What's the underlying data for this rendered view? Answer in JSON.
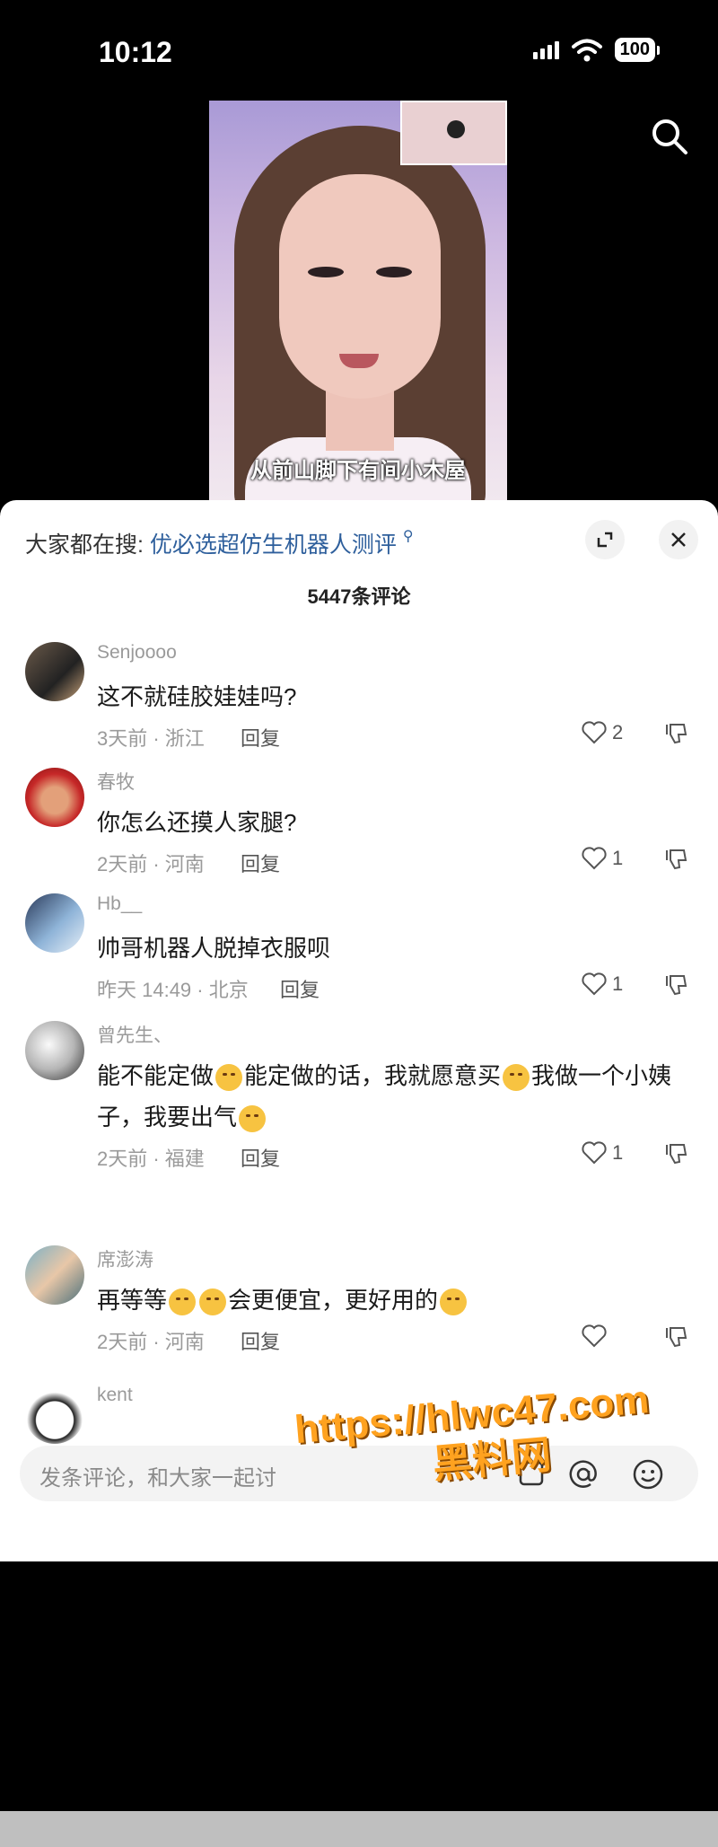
{
  "status_bar": {
    "time": "10:12",
    "battery": "100"
  },
  "video": {
    "caption": "从前山脚下有间小木屋"
  },
  "sheet": {
    "trending_label": "大家都在搜:",
    "trending_query": "优必选超仿生机器人测评",
    "comment_count": "5447条评论"
  },
  "comments": [
    {
      "user": "Senjoooo",
      "text": "这不就硅胶娃娃吗?",
      "meta": "3天前 · 浙江",
      "reply": "回复",
      "likes": "2"
    },
    {
      "user": "春牧",
      "text": "你怎么还摸人家腿?",
      "meta": "2天前 · 河南",
      "reply": "回复",
      "likes": "1"
    },
    {
      "user": "Hb__",
      "text": "帅哥机器人脱掉衣服呗",
      "meta": "昨天 14:49 · 北京",
      "reply": "回复",
      "likes": "1"
    },
    {
      "user": "曾先生、",
      "text_parts": [
        "能不能定做",
        "能定做的话，我就愿意买",
        "我做一个小姨子，我要出气"
      ],
      "meta": "2天前 · 福建",
      "reply": "回复",
      "likes": "1"
    },
    {
      "user": "席澎涛",
      "text_parts": [
        "再等等",
        "会更便宜，更好用的"
      ],
      "meta": "2天前 · 河南",
      "reply": "回复",
      "likes": ""
    },
    {
      "user": "kent"
    }
  ],
  "input": {
    "placeholder": "发条评论，和大家一起讨"
  },
  "watermark": {
    "line1": "https://hlwc47.com",
    "line2": "黑料网"
  },
  "icons": [
    "search-icon",
    "expand-icon",
    "close-icon",
    "heart-icon",
    "dislike-icon",
    "image-icon",
    "at-icon",
    "emoji-icon"
  ]
}
